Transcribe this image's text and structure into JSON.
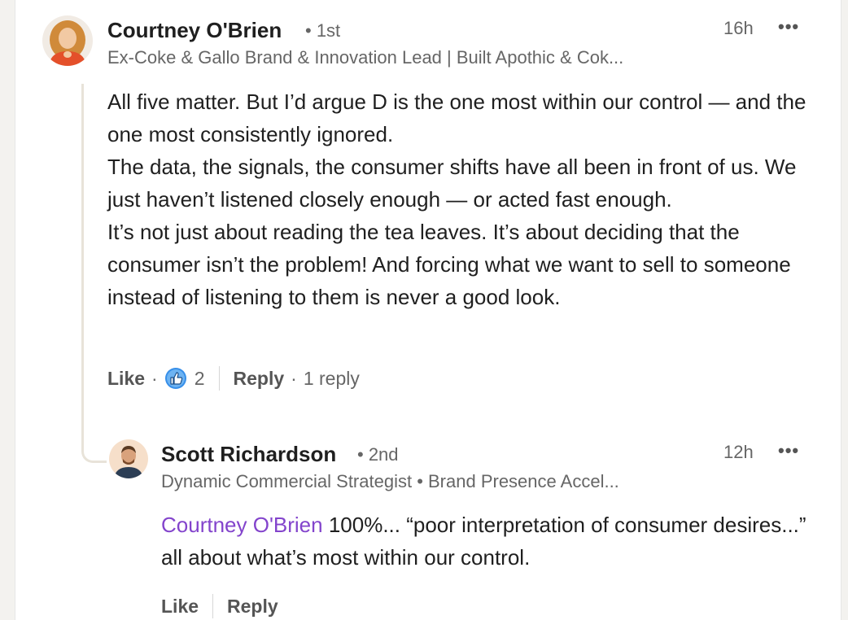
{
  "comment": {
    "author": "Courtney O'Brien",
    "degree": "• 1st",
    "headline": "Ex-Coke & Gallo Brand & Innovation Lead | Built Apothic & Cok...",
    "time": "16h",
    "more": "•••",
    "paragraphs": [
      "All five matter. But I’d argue D is the one most within our control — and the one most consistently ignored.",
      "The data, the signals, the consumer shifts have all been in front of us. We just haven’t listened closely enough — or acted fast enough.",
      "It’s not just about reading the tea leaves. It’s about deciding that the consumer isn’t the problem! And forcing what we want to sell to someone instead of listening to them is never a good look."
    ],
    "like_label": "Like",
    "dot": "·",
    "reaction_count": "2",
    "reply_label": "Reply",
    "replies_count": "1 reply"
  },
  "reply": {
    "author": "Scott Richardson",
    "degree": "• 2nd",
    "headline": "Dynamic Commercial Strategist • Brand Presence Accel...",
    "time": "12h",
    "more": "•••",
    "mention": "Courtney O'Brien",
    "text": " 100%... “poor interpretation of consumer desires...” all about what’s most within our control.",
    "like_label": "Like",
    "reply_label": "Reply"
  },
  "colors": {
    "mention": "#8344cc",
    "like_reaction": "#378fe9",
    "secondary_text": "#666666"
  }
}
